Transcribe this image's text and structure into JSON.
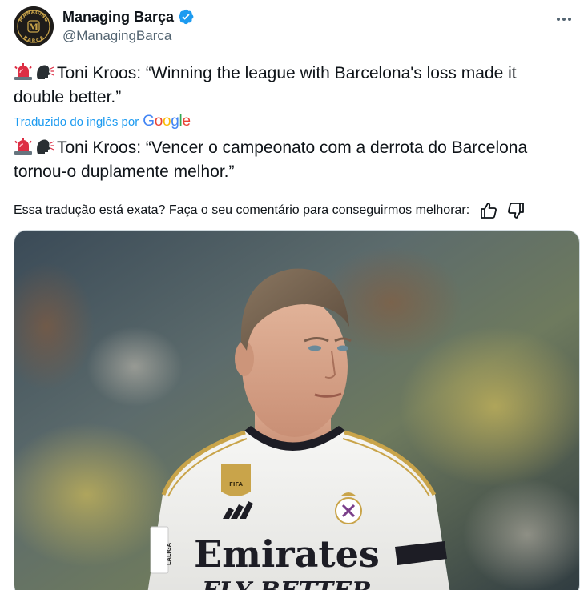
{
  "account": {
    "display_name": "Managing Barça",
    "handle": "@ManagingBarca",
    "avatar_logo_text_top": "MANAGING",
    "avatar_logo_letter": "M",
    "avatar_logo_text_bottom": "BARÇA",
    "verified": true,
    "verified_color": "#1d9bf0"
  },
  "tweet": {
    "original_text": "Toni Kroos: “Winning the league with Barcelona's loss made it double better.”",
    "translated_by_label": "Traduzido do inglês por",
    "translator_brand": "Google",
    "translated_text": "Toni Kroos: “Vencer o campeonato com a derrota do Barcelona tornou-o duplamente melhor.”",
    "emojis": [
      "siren-emoji",
      "speaking-head-emoji"
    ]
  },
  "feedback": {
    "prompt": "Essa tradução está exata? Faça o seu comentário para conseguirmos melhorar:"
  },
  "media": {
    "jersey_sponsor_line1": "Emirates",
    "jersey_sponsor_line2": "FLY BETTER",
    "badge_text": "FIFA",
    "sleeve_text": "LALIGA"
  },
  "colors": {
    "link_blue": "#1d9bf0",
    "secondary_text": "#536471",
    "jersey_gold": "#c9a44a"
  }
}
